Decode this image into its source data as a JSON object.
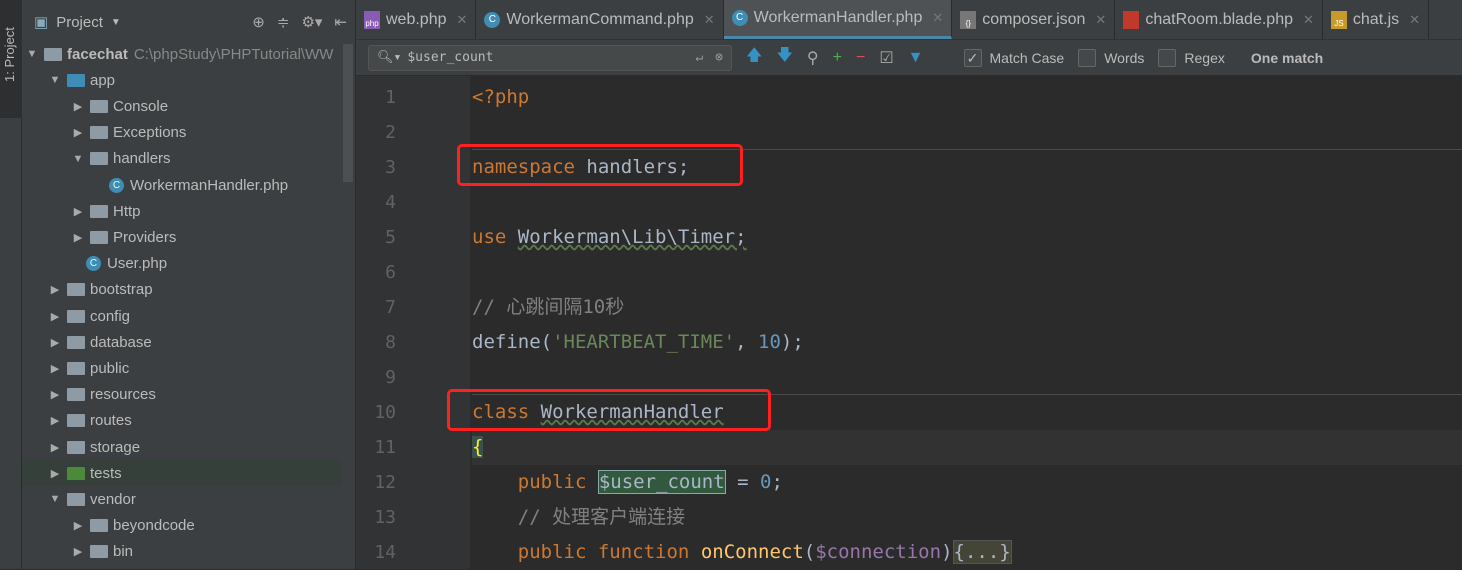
{
  "sidebar_strip": {
    "label": "1: Project"
  },
  "project": {
    "title": "Project",
    "tree": [
      {
        "label": "facechat",
        "path": "C:\\phpStudy\\PHPTutorial\\WW",
        "depth": 0,
        "type": "folder",
        "expanded": true,
        "bold": true
      },
      {
        "label": "app",
        "depth": 1,
        "type": "folder-blue",
        "expanded": true
      },
      {
        "label": "Console",
        "depth": 2,
        "type": "folder",
        "expanded": false
      },
      {
        "label": "Exceptions",
        "depth": 2,
        "type": "folder",
        "expanded": false
      },
      {
        "label": "handlers",
        "depth": 2,
        "type": "folder",
        "expanded": true
      },
      {
        "label": "WorkermanHandler.php",
        "depth": 3,
        "type": "class"
      },
      {
        "label": "Http",
        "depth": 2,
        "type": "folder",
        "expanded": false
      },
      {
        "label": "Providers",
        "depth": 2,
        "type": "folder",
        "expanded": false
      },
      {
        "label": "User.php",
        "depth": 2,
        "type": "class"
      },
      {
        "label": "bootstrap",
        "depth": 1,
        "type": "folder",
        "expanded": false
      },
      {
        "label": "config",
        "depth": 1,
        "type": "folder",
        "expanded": false
      },
      {
        "label": "database",
        "depth": 1,
        "type": "folder",
        "expanded": false
      },
      {
        "label": "public",
        "depth": 1,
        "type": "folder",
        "expanded": false
      },
      {
        "label": "resources",
        "depth": 1,
        "type": "folder",
        "expanded": false
      },
      {
        "label": "routes",
        "depth": 1,
        "type": "folder",
        "expanded": false
      },
      {
        "label": "storage",
        "depth": 1,
        "type": "folder",
        "expanded": false
      },
      {
        "label": "tests",
        "depth": 1,
        "type": "folder-green",
        "expanded": false,
        "selected": true
      },
      {
        "label": "vendor",
        "depth": 1,
        "type": "folder",
        "expanded": true
      },
      {
        "label": "beyondcode",
        "depth": 2,
        "type": "folder",
        "expanded": false
      },
      {
        "label": "bin",
        "depth": 2,
        "type": "folder",
        "expanded": false
      }
    ]
  },
  "tabs": [
    {
      "label": "web.php",
      "icon": "php-file-icon",
      "active": false
    },
    {
      "label": "WorkermanCommand.php",
      "icon": "class-icon",
      "active": false
    },
    {
      "label": "WorkermanHandler.php",
      "icon": "class-icon",
      "active": true
    },
    {
      "label": "composer.json",
      "icon": "json-file-icon",
      "active": false
    },
    {
      "label": "chatRoom.blade.php",
      "icon": "blade-file-icon",
      "active": false
    },
    {
      "label": "chat.js",
      "icon": "js-file-icon",
      "active": false
    }
  ],
  "search": {
    "query": "$user_count",
    "match_case": "Match Case",
    "match_case_checked": true,
    "words": "Words",
    "words_checked": false,
    "regex": "Regex",
    "regex_checked": false,
    "result": "One match"
  },
  "code": {
    "lines": [
      [
        [
          "kw",
          "<?php"
        ]
      ],
      [],
      [
        [
          "kw",
          "namespace"
        ],
        [
          "",
          "handlers;"
        ]
      ],
      [],
      [
        [
          "kw",
          "use"
        ],
        [
          "",
          ""
        ],
        [
          "wav",
          "Workerman\\Lib\\Timer;"
        ]
      ],
      [],
      [
        [
          "cm",
          "// 心跳间隔10秒"
        ]
      ],
      [
        [
          "",
          "define("
        ],
        [
          "str",
          "'HEARTBEAT_TIME'"
        ],
        [
          "",
          ", "
        ],
        [
          "num",
          "10"
        ],
        [
          "",
          ");"
        ]
      ],
      [],
      [
        [
          "kw",
          "class"
        ],
        [
          "",
          ""
        ],
        [
          "wav",
          "WorkermanHandler"
        ]
      ],
      [
        [
          "brace",
          "{"
        ]
      ],
      [
        [
          "",
          "    "
        ],
        [
          "kw",
          "public"
        ],
        [
          "",
          ""
        ],
        [
          "hl",
          "$user_count"
        ],
        [
          "",
          ""
        ],
        [
          "",
          "= "
        ],
        [
          "num",
          "0"
        ],
        [
          "",
          ";"
        ]
      ],
      [
        [
          "",
          "    "
        ],
        [
          "cm",
          "// 处理客户端连接"
        ]
      ],
      [
        [
          "",
          "    "
        ],
        [
          "kw",
          "public function"
        ],
        [
          "",
          ""
        ],
        [
          "fn",
          "onConnect"
        ],
        [
          "",
          "("
        ],
        [
          "var",
          "$connection"
        ],
        [
          "",
          ")"
        ],
        [
          "foldbox",
          "{...}"
        ]
      ]
    ]
  }
}
